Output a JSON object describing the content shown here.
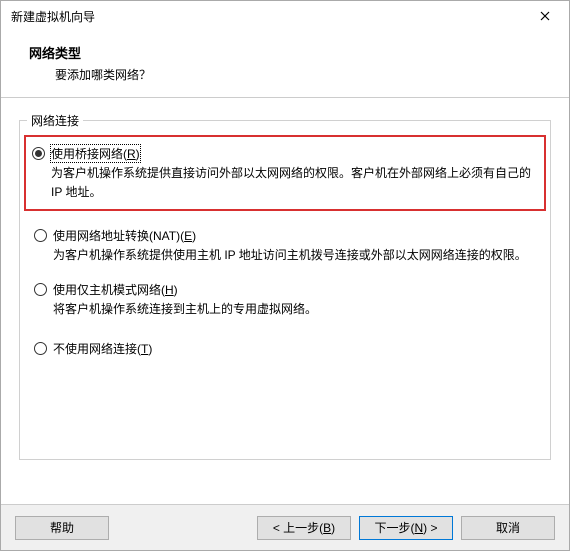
{
  "window": {
    "title": "新建虚拟机向导"
  },
  "header": {
    "title": "网络类型",
    "subtitle": "要添加哪类网络？"
  },
  "group": {
    "legend": "网络连接"
  },
  "options": {
    "bridged": {
      "label_pre": "使用桥接网络(",
      "mnemonic": "R",
      "label_post": ")",
      "desc": "为客户机操作系统提供直接访问外部以太网网络的权限。客户机在外部网络上必须有自己的 IP 地址。"
    },
    "nat": {
      "label_pre": "使用网络地址转换(NAT)(",
      "mnemonic": "E",
      "label_post": ")",
      "desc": "为客户机操作系统提供使用主机 IP 地址访问主机拨号连接或外部以太网网络连接的权限。"
    },
    "hostonly": {
      "label_pre": "使用仅主机模式网络(",
      "mnemonic": "H",
      "label_post": ")",
      "desc": "将客户机操作系统连接到主机上的专用虚拟网络。"
    },
    "none": {
      "label_pre": "不使用网络连接(",
      "mnemonic": "T",
      "label_post": ")"
    }
  },
  "buttons": {
    "help": "帮助",
    "back_pre": "< 上一步(",
    "back_m": "B",
    "back_post": ")",
    "next_pre": "下一步(",
    "next_m": "N",
    "next_post": ") >",
    "cancel": "取消"
  }
}
